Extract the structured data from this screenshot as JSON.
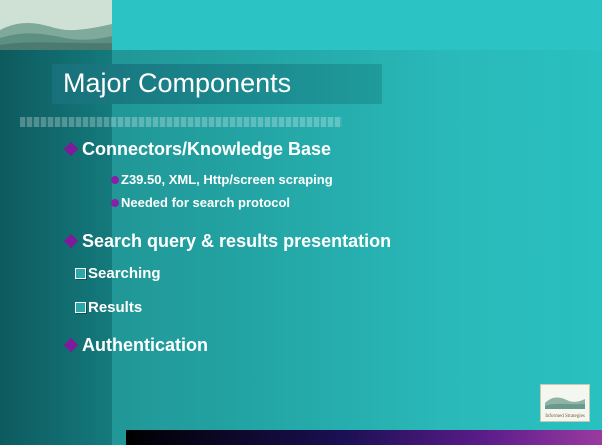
{
  "slide": {
    "title": "Major Components",
    "items": [
      {
        "level": 1,
        "bullet": "diamond",
        "text": "Connectors/Knowledge Base"
      },
      {
        "level": 2,
        "bullet": "dot",
        "text": "Z39.50, XML, Http/screen scraping"
      },
      {
        "level": 2,
        "bullet": "dot",
        "text": "Needed for search protocol"
      },
      {
        "level": 1,
        "bullet": "diamond",
        "text": "Search query & results presentation"
      },
      {
        "level": 2,
        "bullet": "box",
        "text": "Searching"
      },
      {
        "level": 2,
        "bullet": "box",
        "text": "Results"
      },
      {
        "level": 1,
        "bullet": "diamond",
        "text": "Authentication"
      }
    ]
  },
  "footer": {
    "logo_text": "Informed Strategies",
    "logo_icon": "mountain-landscape-icon"
  },
  "header": {
    "logo_icon": "mountain-landscape-icon"
  },
  "colors": {
    "background": "#23a3a3",
    "left_band": "#0d5a5e",
    "bullet_diamond": "#7f1a9a",
    "bullet_dot": "#8a1fa8",
    "text": "#ffffff"
  }
}
